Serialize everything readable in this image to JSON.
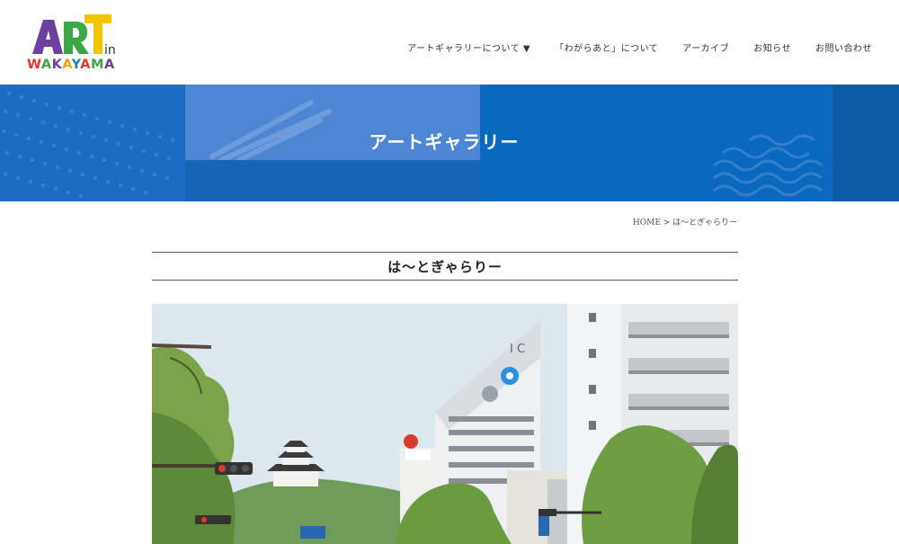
{
  "header": {
    "logo": {
      "art": "ART",
      "in": "in",
      "wakayama": "WAKAYAMA"
    },
    "nav": [
      {
        "label": "アートギャラリーについて ▼"
      },
      {
        "label": "「わがらあと」について"
      },
      {
        "label": "アーカイブ"
      },
      {
        "label": "お知らせ"
      },
      {
        "label": "お問い合わせ"
      }
    ]
  },
  "hero": {
    "title": "アートギャラリー"
  },
  "breadcrumb": {
    "home": "HOME",
    "separator": " > ",
    "current": "は〜とぎゃらりー"
  },
  "page": {
    "title": "は〜とぎゃらりー"
  },
  "photo": {
    "building_sign": "I C"
  },
  "colors": {
    "hero_blue": "#1565b4",
    "hero_light": "#4f86d3",
    "logo_purple": "#6a3fa0",
    "logo_yellow": "#f2c500",
    "logo_green": "#3aa845",
    "logo_red": "#e2352e"
  }
}
